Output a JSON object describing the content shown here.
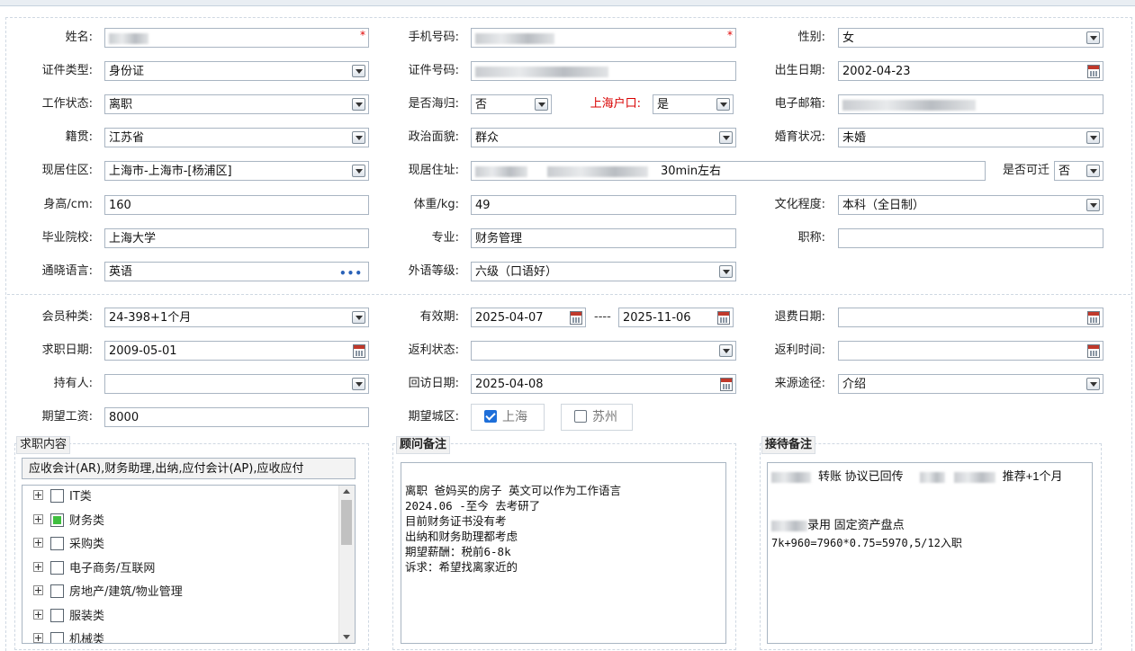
{
  "form": {
    "name": {
      "label": "姓名:",
      "required": "*"
    },
    "phone": {
      "label": "手机号码:",
      "required": "*"
    },
    "gender": {
      "label": "性别:",
      "value": "女"
    },
    "id_type": {
      "label": "证件类型:",
      "value": "身份证"
    },
    "id_number": {
      "label": "证件号码:"
    },
    "birth_date": {
      "label": "出生日期:",
      "value": "2002-04-23"
    },
    "work_status": {
      "label": "工作状态:",
      "value": "离职"
    },
    "overseas": {
      "label": "是否海归:",
      "value": "否"
    },
    "shanghai_hukou": {
      "label": "上海户口:",
      "value": "是"
    },
    "email": {
      "label": "电子邮箱:"
    },
    "native_place": {
      "label": "籍贯:",
      "value": "江苏省"
    },
    "political": {
      "label": "政治面貌:",
      "value": "群众"
    },
    "marital": {
      "label": "婚育状况:",
      "value": "未婚"
    },
    "residence_area": {
      "label": "现居住区:",
      "value": "上海市-上海市-[杨浦区]"
    },
    "residence_address": {
      "label": "现居住址:",
      "value_suffix": "30min左右"
    },
    "relocate": {
      "label": "是否可迁",
      "value": "否"
    },
    "height": {
      "label": "身高/cm:",
      "value": "160"
    },
    "weight": {
      "label": "体重/kg:",
      "value": "49"
    },
    "education": {
      "label": "文化程度:",
      "value": "本科（全日制）"
    },
    "school": {
      "label": "毕业院校:",
      "value": "上海大学"
    },
    "major": {
      "label": "专业:",
      "value": "财务管理"
    },
    "title": {
      "label": "职称:",
      "value": ""
    },
    "language": {
      "label": "通晓语言:",
      "value": "英语",
      "more": "•••"
    },
    "language_level": {
      "label": "外语等级:",
      "value": "六级（口语好）"
    }
  },
  "membership": {
    "type": {
      "label": "会员种类:",
      "value": "24-398+1个月"
    },
    "valid": {
      "label": "有效期:",
      "start": "2025-04-07",
      "sep": "----",
      "end": "2025-11-06"
    },
    "refund_date": {
      "label": "退费日期:",
      "value": ""
    },
    "job_date": {
      "label": "求职日期:",
      "value": "2009-05-01"
    },
    "rebate_status": {
      "label": "返利状态:",
      "value": ""
    },
    "rebate_time": {
      "label": "返利时间:",
      "value": ""
    },
    "holder": {
      "label": "持有人:",
      "value": ""
    },
    "visit_date": {
      "label": "回访日期:",
      "value": "2025-04-08"
    },
    "source": {
      "label": "来源途径:",
      "value": "介绍"
    },
    "salary": {
      "label": "期望工资:",
      "value": "8000"
    },
    "city": {
      "label": "期望城区:",
      "options": [
        {
          "label": "上海",
          "checked": true
        },
        {
          "label": "苏州",
          "checked": false
        }
      ]
    }
  },
  "job_content": {
    "legend": "求职内容",
    "summary": "应收会计(AR),财务助理,出纳,应付会计(AP),应收应付",
    "tree": [
      {
        "label": "IT类",
        "state": "none"
      },
      {
        "label": "财务类",
        "state": "partial"
      },
      {
        "label": "采购类",
        "state": "none"
      },
      {
        "label": "电子商务/互联网",
        "state": "none"
      },
      {
        "label": "房地产/建筑/物业管理",
        "state": "none"
      },
      {
        "label": "服装类",
        "state": "none"
      },
      {
        "label": "机械类",
        "state": "none"
      }
    ]
  },
  "advisor_notes": {
    "legend": "顾问备注",
    "lines": [
      "离职 爸妈买的房子 英文可以作为工作语言",
      "2024.06 -至今 去考研了",
      "目前财务证书没有考",
      "出纳和财务助理都考虑",
      "期望薪酬：税前6-8k",
      "诉求：希望找离家近的"
    ]
  },
  "reception_notes": {
    "legend": "接待备注",
    "line1_a": "转账 协议已回传",
    "line1_b": "推荐+1个月",
    "line2": "录用 固定资产盘点",
    "line3": "7k+960=7960*0.75=5970,5/12入职"
  }
}
